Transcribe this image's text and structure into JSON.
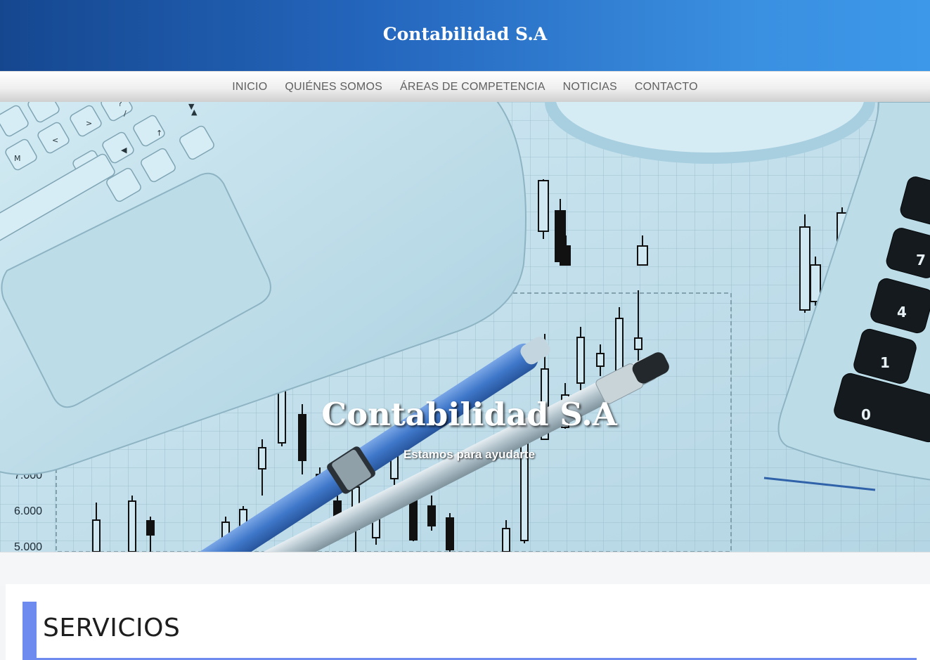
{
  "header": {
    "site_title": "Contabilidad S.A"
  },
  "nav": {
    "items": [
      {
        "label": "INICIO"
      },
      {
        "label": "QUIÉNES SOMOS"
      },
      {
        "label": "ÁREAS DE COMPETENCIA"
      },
      {
        "label": "NOTICIAS"
      },
      {
        "label": "CONTACTO"
      }
    ]
  },
  "hero": {
    "title": "Contabilidad S.A",
    "subtitle": "Estamos para ayudarte",
    "image_axis_labels": [
      "7.000",
      "6.000",
      "5.000"
    ],
    "calculator_keys": [
      "7",
      "4",
      "1",
      "0"
    ],
    "keyboard_keys": [
      "M",
      "<",
      ">",
      "?",
      "/",
      "↑",
      "◀",
      "▲",
      "▼"
    ]
  },
  "services": {
    "title": "SERVICIOS"
  },
  "colors": {
    "header_start": "#15478f",
    "header_end": "#3d98ea",
    "accent": "#6e8cf0",
    "nav_text": "#5f5f5f"
  }
}
